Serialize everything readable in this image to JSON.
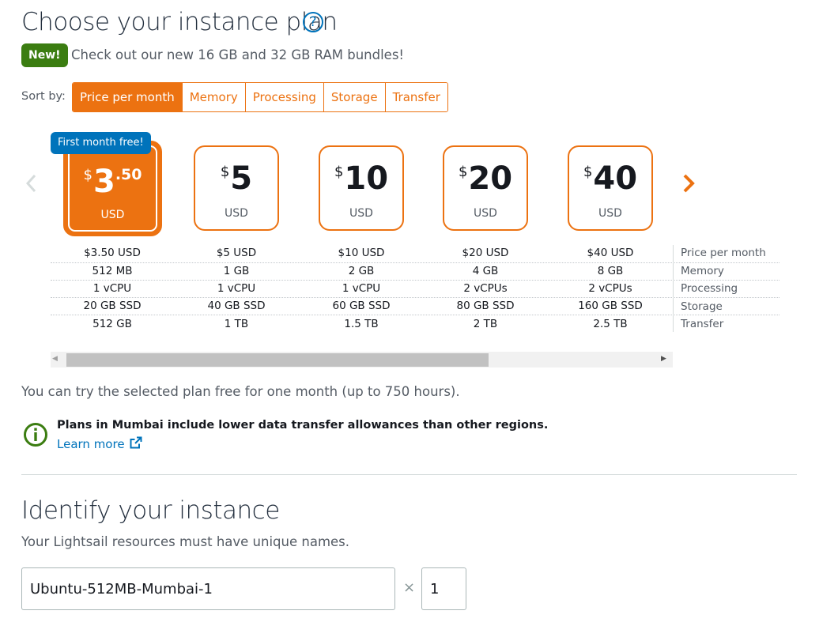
{
  "header": {
    "title": "Choose your instance plan",
    "help_icon": "?"
  },
  "announcement": {
    "badge": "New!",
    "text": "Check out our new 16 GB and 32 GB RAM bundles!"
  },
  "sort": {
    "label": "Sort by:",
    "options": [
      "Price per month",
      "Memory",
      "Processing",
      "Storage",
      "Transfer"
    ],
    "selected": "Price per month"
  },
  "plans": [
    {
      "symbol": "$",
      "amount": "3",
      "cents": ".50",
      "currency": "USD",
      "selected": true,
      "badge": "First month free!",
      "price": "$3.50 USD",
      "memory": "512 MB",
      "processing": "1 vCPU",
      "storage": "20 GB SSD",
      "transfer": "512 GB"
    },
    {
      "symbol": "$",
      "amount": "5",
      "cents": "",
      "currency": "USD",
      "selected": false,
      "price": "$5 USD",
      "memory": "1 GB",
      "processing": "1 vCPU",
      "storage": "40 GB SSD",
      "transfer": "1 TB"
    },
    {
      "symbol": "$",
      "amount": "10",
      "cents": "",
      "currency": "USD",
      "selected": false,
      "price": "$10 USD",
      "memory": "2 GB",
      "processing": "1 vCPU",
      "storage": "60 GB SSD",
      "transfer": "1.5 TB"
    },
    {
      "symbol": "$",
      "amount": "20",
      "cents": "",
      "currency": "USD",
      "selected": false,
      "price": "$20 USD",
      "memory": "4 GB",
      "processing": "2 vCPUs",
      "storage": "80 GB SSD",
      "transfer": "2 TB"
    },
    {
      "symbol": "$",
      "amount": "40",
      "cents": "",
      "currency": "USD",
      "selected": false,
      "price": "$40 USD",
      "memory": "8 GB",
      "processing": "2 vCPUs",
      "storage": "160 GB SSD",
      "transfer": "2.5 TB"
    }
  ],
  "spec_labels": {
    "price": "Price per month",
    "memory": "Memory",
    "processing": "Processing",
    "storage": "Storage",
    "transfer": "Transfer"
  },
  "carousel": {
    "prev_icon": "chevron-left-icon",
    "next_icon": "chevron-right-icon",
    "scroll_left": "◀",
    "scroll_right": "▶"
  },
  "trial_text": "You can try the selected plan free for one month (up to 750 hours).",
  "alert": {
    "icon": "info-icon",
    "text": "Plans in Mumbai include lower data transfer allowances than other regions.",
    "link": "Learn more",
    "link_icon": "external-link-icon"
  },
  "identify": {
    "title": "Identify your instance",
    "subtitle": "Your Lightsail resources must have unique names.",
    "name_value": "Ubuntu-512MB-Mumbai-1",
    "times": "×",
    "count_value": "1"
  },
  "colors": {
    "accent": "#ec7211",
    "link": "#0073bb",
    "success": "#3b7d11",
    "info_icon": "#3b7d11"
  }
}
